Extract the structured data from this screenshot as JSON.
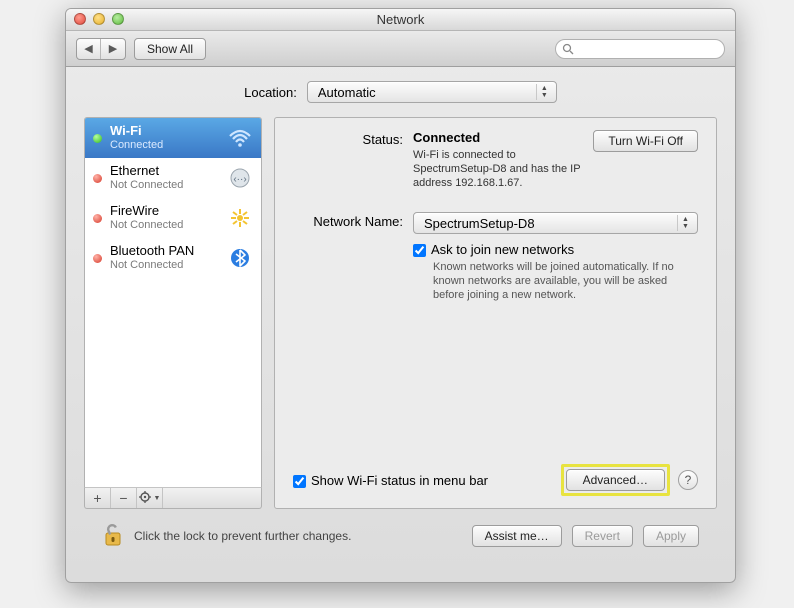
{
  "window": {
    "title": "Network"
  },
  "toolbar": {
    "show_all": "Show All",
    "search_placeholder": ""
  },
  "location": {
    "label": "Location:",
    "value": "Automatic"
  },
  "services": [
    {
      "name": "Wi-Fi",
      "status": "Connected",
      "dot": "green",
      "selected": true
    },
    {
      "name": "Ethernet",
      "status": "Not Connected",
      "dot": "red",
      "selected": false
    },
    {
      "name": "FireWire",
      "status": "Not Connected",
      "dot": "red",
      "selected": false
    },
    {
      "name": "Bluetooth PAN",
      "status": "Not Connected",
      "dot": "red",
      "selected": false
    }
  ],
  "detail": {
    "status_label": "Status:",
    "status_value": "Connected",
    "turn_off_btn": "Turn Wi-Fi Off",
    "status_sub": "Wi-Fi is connected to SpectrumSetup-D8 and has the IP address 192.168.1.67.",
    "network_label": "Network Name:",
    "network_value": "SpectrumSetup-D8",
    "ask_join": "Ask to join new networks",
    "ask_join_sub": "Known networks will be joined automatically. If no known networks are available, you will be asked before joining a new network.",
    "show_menu": "Show Wi-Fi status in menu bar",
    "advanced_btn": "Advanced…"
  },
  "bottom": {
    "lock_text": "Click the lock to prevent further changes.",
    "assist": "Assist me…",
    "revert": "Revert",
    "apply": "Apply"
  },
  "glyphs": {
    "plus": "+",
    "minus": "−",
    "gear": "✻▾",
    "help": "?"
  }
}
